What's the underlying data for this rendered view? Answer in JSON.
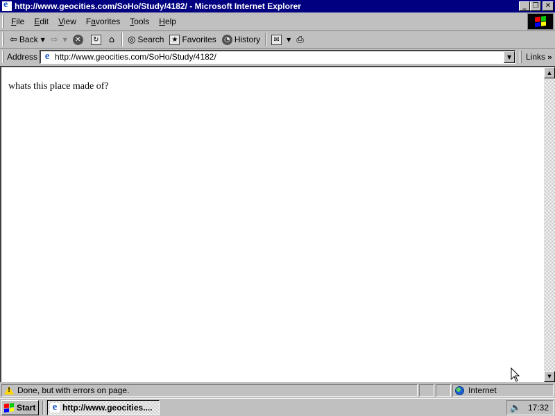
{
  "window": {
    "title": "http://www.geocities.com/SoHo/Study/4182/ - Microsoft Internet Explorer",
    "min_glyph": "_",
    "restore_glyph": "❐",
    "close_glyph": "✕"
  },
  "menu": {
    "items": [
      {
        "key": "F",
        "rest": "ile"
      },
      {
        "key": "E",
        "rest": "dit"
      },
      {
        "key": "V",
        "rest": "iew"
      },
      {
        "key": "F",
        "rest": "a",
        "note": "Favorites",
        "label": "Favorites"
      },
      {
        "key": "T",
        "rest": "ools"
      },
      {
        "key": "H",
        "rest": "elp"
      }
    ]
  },
  "toolbar": {
    "back_label": "Back",
    "search_label": "Search",
    "favorites_label": "Favorites",
    "history_label": "History"
  },
  "address": {
    "label": "Address",
    "url": "http://www.geocities.com/SoHo/Study/4182/",
    "links_label": "Links",
    "links_chevron": "»"
  },
  "page": {
    "text": "whats this place made of?"
  },
  "status": {
    "message": "Done, but with errors on page.",
    "zone": "Internet"
  },
  "taskbar": {
    "start_label": "Start",
    "task_label": "http://www.geocities....",
    "clock": "17:32"
  },
  "colors": {
    "titlebar": "#000080",
    "chrome": "#c0c0c0",
    "content_bg": "#ffffff"
  }
}
